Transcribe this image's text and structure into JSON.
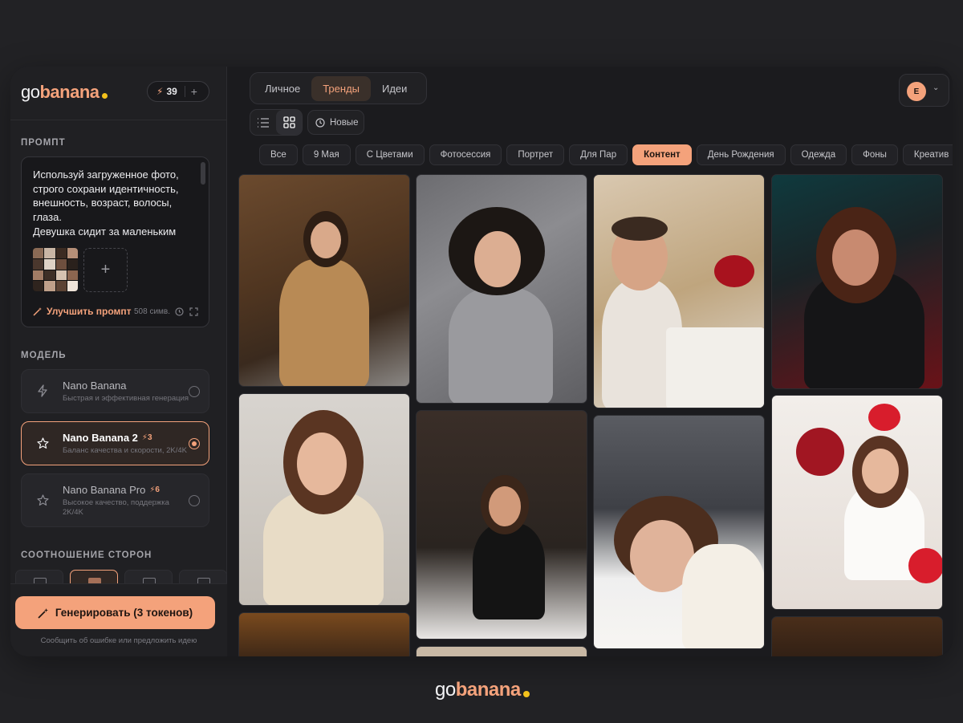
{
  "brand": {
    "go": "go",
    "banana": "banana",
    "dot_color": "#f3c11b",
    "accent": "#f4a27b"
  },
  "tokens": {
    "count": "39",
    "icon": "bolt-icon",
    "add": "+"
  },
  "prompt": {
    "section_title": "ПРОМПТ",
    "text": "Используй загруженное фото, строго сохрани идентичность, внешность, возраст, волосы, глаза.\nДевушка сидит за маленьким столиком в кафейне, читает",
    "improve_label": "Улучшить промпт",
    "char_count": "508 симв."
  },
  "model": {
    "section_title": "МОДЕЛЬ",
    "items": [
      {
        "name": "Nano Banana",
        "cost": "",
        "desc": "Быстрая и эффективная генерация",
        "icon": "bolt-icon",
        "selected": false
      },
      {
        "name": "Nano Banana 2",
        "cost": "3",
        "desc": "Баланс качества и скорости, 2K/4K",
        "icon": "star-icon",
        "selected": true
      },
      {
        "name": "Nano Banana Pro",
        "cost": "6",
        "desc": "Высокое качество, поддержка 2K/4K",
        "icon": "star-icon",
        "selected": false
      }
    ]
  },
  "aspect": {
    "section_title": "СООТНОШЕНИЕ СТОРОН"
  },
  "generate": {
    "label": "Генерировать (3 токенов)",
    "feedback": "Сообщить об ошибке или предложить идею"
  },
  "tabs": [
    {
      "label": "Личное",
      "active": false
    },
    {
      "label": "Тренды",
      "active": true
    },
    {
      "label": "Идеи",
      "active": false
    }
  ],
  "user": {
    "initial": "E"
  },
  "sort": {
    "label": "Новые"
  },
  "chips": [
    {
      "label": "Все",
      "active": false
    },
    {
      "label": "9 Мая",
      "active": false
    },
    {
      "label": "С Цветами",
      "active": false
    },
    {
      "label": "Фотосессия",
      "active": false
    },
    {
      "label": "Портрет",
      "active": false
    },
    {
      "label": "Для Пар",
      "active": false
    },
    {
      "label": "Контент",
      "active": true
    },
    {
      "label": "День Рождения",
      "active": false
    },
    {
      "label": "Одежда",
      "active": false
    },
    {
      "label": "Фоны",
      "active": false
    },
    {
      "label": "Креатив",
      "active": false
    }
  ],
  "footer": {
    "go": "go",
    "banana": "banana"
  }
}
